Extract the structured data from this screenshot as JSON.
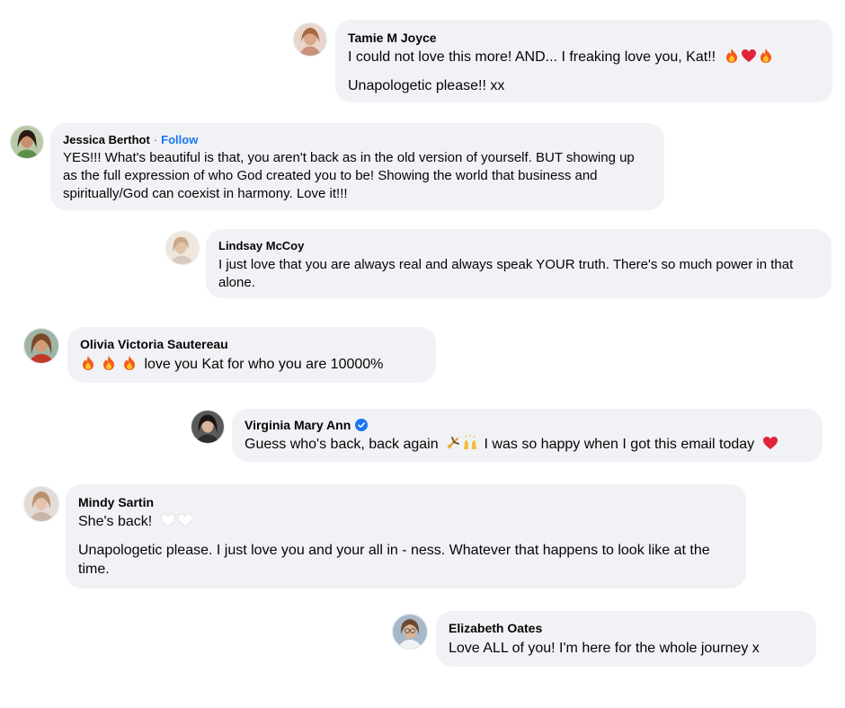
{
  "comments": [
    {
      "author": "Tamie M Joyce",
      "text": "I could not love this more! AND... I freaking love you, Kat!!",
      "emojis_after_text": [
        "fire",
        "red-heart",
        "fire"
      ],
      "text2": "Unapologetic please!! xx"
    },
    {
      "author": "Jessica Berthot",
      "separator": "·",
      "follow_label": "Follow",
      "text": "YES!!! What's beautiful is that, you aren't back as in the old version of yourself. BUT showing up as the full expression of who God created you to be! Showing the world that business and spiritually/God can coexist in harmony. Love it!!!"
    },
    {
      "author": "Lindsay McCoy",
      "text": "I just love that you are always real and always speak YOUR truth. There's so much power in that alone."
    },
    {
      "author": "Olivia Victoria Sautereau",
      "emojis_before_text": [
        "fire",
        "fire",
        "fire"
      ],
      "text": "love you Kat for who you are 10000%"
    },
    {
      "author": "Virginia Mary Ann",
      "verified": true,
      "text_part1": "Guess who's back, back again",
      "emojis_mid": [
        "cartwheel",
        "raised-hands"
      ],
      "text_part2": "I was so happy when I got this email today",
      "emojis_after_text": [
        "red-heart"
      ]
    },
    {
      "author": "Mindy Sartin",
      "text": "She's back!",
      "emojis_after_text": [
        "white-heart",
        "white-heart"
      ],
      "text2": "Unapologetic please. I just love you and your all in - ness. Whatever that happens to look like at the time."
    },
    {
      "author": "Elizabeth Oates",
      "text": "Love ALL of you! I'm here for the whole journey x"
    }
  ],
  "colors": {
    "bubble_bg": "#f0f2f5",
    "follow_link": "#1877f2",
    "verified_badge": "#1877f2",
    "text": "#050505"
  }
}
